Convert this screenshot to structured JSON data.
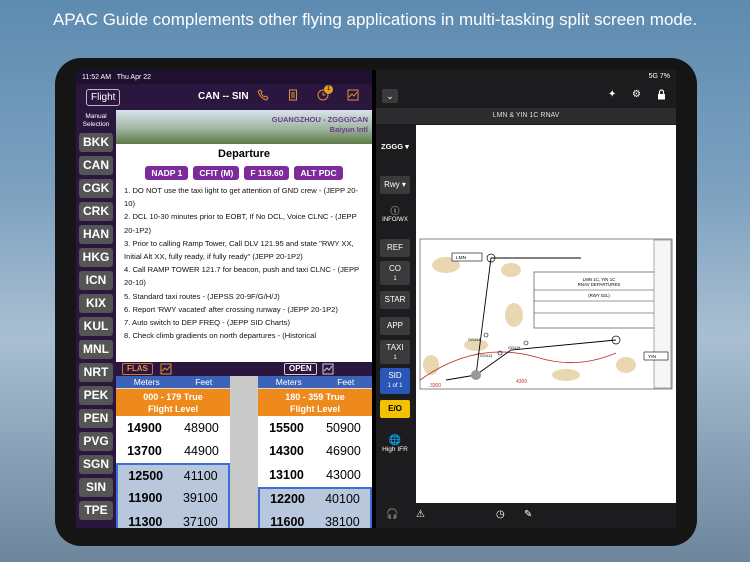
{
  "caption": "APAC Guide complements other flying applications in multi-tasking split screen mode.",
  "left": {
    "status": {
      "time": "11:52 AM",
      "date": "Thu Apr 22"
    },
    "header": {
      "flight": "Flight",
      "route": "CAN -- SIN",
      "badge": "1"
    },
    "sidebar": {
      "label1": "Manual",
      "label2": "Selection",
      "codes": [
        "BKK",
        "CAN",
        "CGK",
        "CRK",
        "HAN",
        "HKG",
        "ICN",
        "KIX",
        "KUL",
        "MNL",
        "NRT",
        "PEK",
        "PEN",
        "PVG",
        "SGN",
        "SIN",
        "TPE"
      ]
    },
    "banner": {
      "title": "GUANGZHOU - ZGGG/CAN",
      "subtitle": "Baiyun Intl"
    },
    "departure": {
      "title": "Departure",
      "pills": [
        "NADP 1",
        "CFIT (M)",
        "F 119.60",
        "ALT PDC"
      ],
      "items": [
        "1. DO NOT use the taxi light to get attention of GND crew - (JEPP 20-10)",
        "2. DCL 10-30 minutes prior to EOBT, If No DCL, Voice CLNC - (JEPP 20-1P2)",
        "3. Prior to calling Ramp Tower, Call DLV 121.95 and state \"RWY XX, Initial Alt XX, fully ready, if fully ready\" (JEPP 20-1P2)",
        "4. Call RAMP TOWER 121.7 for beacon, push and taxi CLNC - (JEPP 20-10)",
        "5. Standard taxi routes - (JEPSS 20-9F/G/H/J)",
        "6. Report 'RWY vacated' after crossing runway - (JEPP 20-1P2)",
        "7. Auto switch to DEP FREQ - (JEPP SID Charts)",
        "8. Check climb gradients on north departures - (Historical"
      ]
    },
    "flas": {
      "flas_label": "FLAS",
      "open_label": "OPEN",
      "left": {
        "meters": "Meters",
        "feet": "Feet",
        "band1": "000 - 179 True",
        "band2": "Flight Level",
        "rows": [
          {
            "m": "14900",
            "f": "48900"
          },
          {
            "m": "13700",
            "f": "44900"
          },
          {
            "m": "12500",
            "f": "41100"
          },
          {
            "m": "11900",
            "f": "39100"
          },
          {
            "m": "11300",
            "f": "37100"
          }
        ]
      },
      "right": {
        "meters": "Meters",
        "feet": "Feet",
        "band1": "180 - 359 True",
        "band2": "Flight Level",
        "rows": [
          {
            "m": "15500",
            "f": "50900"
          },
          {
            "m": "14300",
            "f": "46900"
          },
          {
            "m": "13100",
            "f": "43000"
          },
          {
            "m": "12200",
            "f": "40100"
          },
          {
            "m": "11600",
            "f": "38100"
          }
        ]
      }
    }
  },
  "right": {
    "status": "5G  7%",
    "chart_title": "LMN & YIN 1C RNAV",
    "airport": "ZGGG",
    "buttons": {
      "rwy": "Rwy",
      "info": "INFO/WX",
      "ref": "REF",
      "co": "CO",
      "co_n": "1",
      "star": "STAR",
      "app": "APP",
      "taxi": "TAXI",
      "taxi_n": "1",
      "sid": "SID",
      "sid_n": "1 of 1",
      "eo": "E/O",
      "ifr": "High IFR"
    },
    "plate": {
      "name1": "LMN 1C, YIN 1C",
      "name2": "RNAV DEPARTURES",
      "name3": "(RWY 02L)",
      "fix1": "LMN",
      "fix2": "YIN",
      "alt1": "3300",
      "alt2": "4300",
      "fixes": [
        "GG414",
        "GG419",
        "GG413"
      ]
    }
  }
}
